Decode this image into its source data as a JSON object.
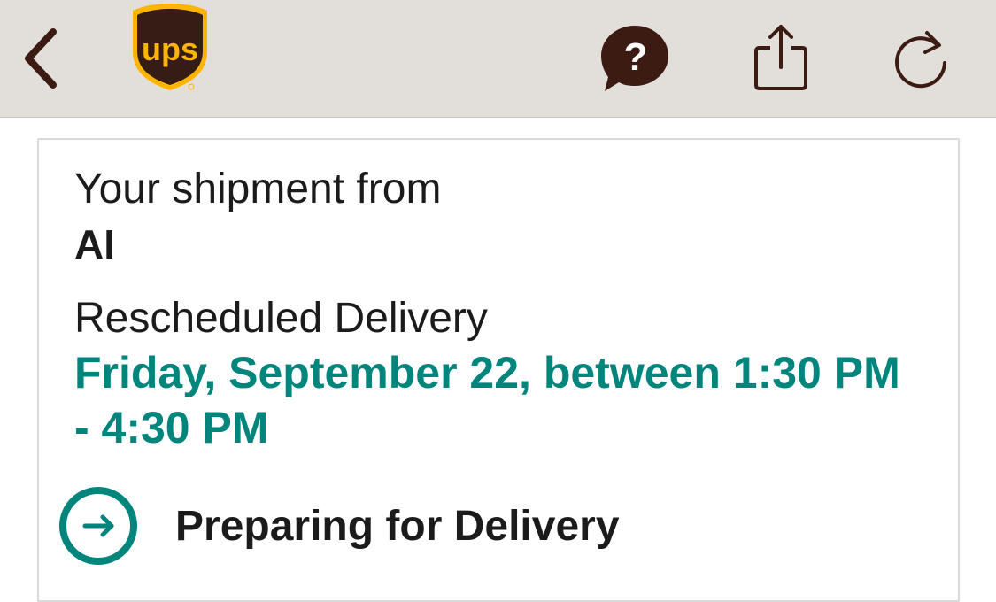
{
  "header": {
    "logo_text": "ups",
    "icons": {
      "back": "chevron-left-icon",
      "help": "help-bubble-icon",
      "share": "share-icon",
      "refresh": "refresh-icon"
    }
  },
  "shipment": {
    "from_label": "Your shipment from",
    "from_name": "AI",
    "delivery_label": "Rescheduled Delivery",
    "delivery_window": "Friday, September 22, between 1:30 PM - 4:30 PM",
    "status": "Preparing for Delivery",
    "status_icon": "arrow-right-circle-icon"
  },
  "colors": {
    "brand_brown": "#351c15",
    "brand_gold": "#ffb500",
    "accent_teal": "#00857d",
    "header_bg": "#e2dfdb"
  }
}
